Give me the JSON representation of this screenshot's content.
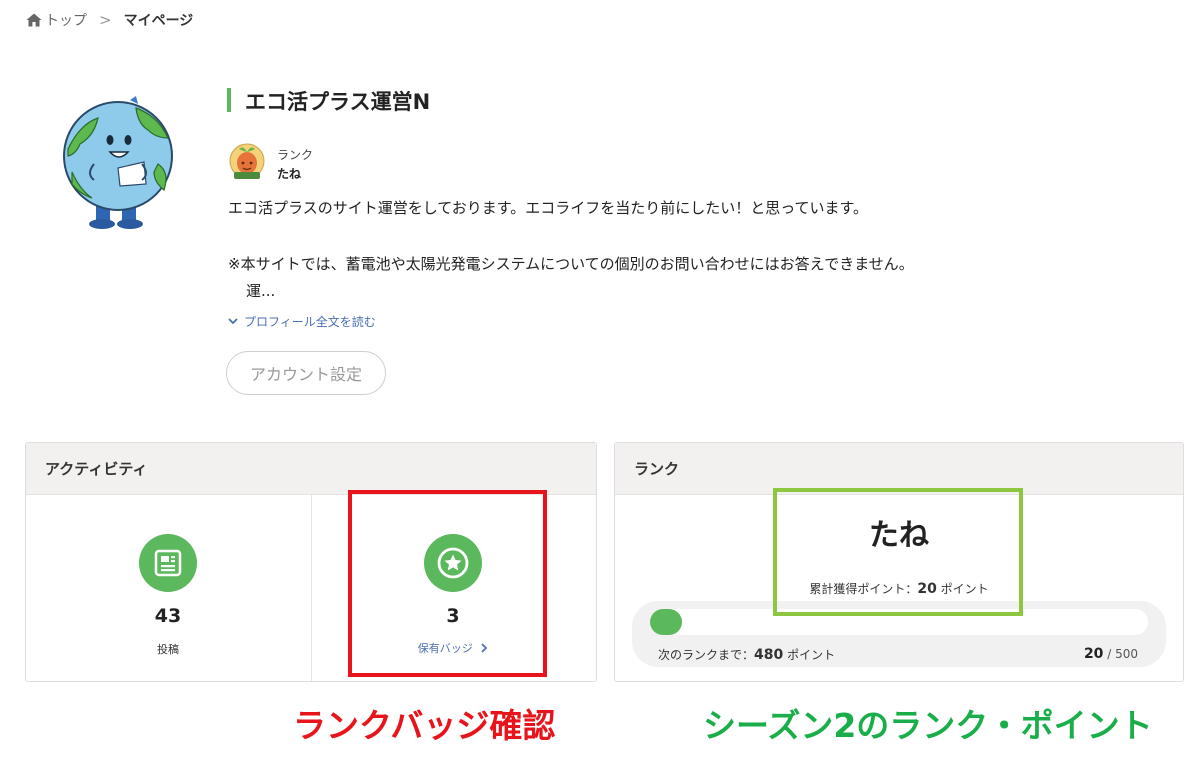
{
  "breadcrumb": {
    "home": "トップ",
    "separator": ">",
    "current": "マイページ"
  },
  "profile": {
    "name": "エコ活プラス運営N",
    "rank_caption": "ランク",
    "rank_name": "たね",
    "bio_line1": "エコ活プラスのサイト運営をしております。エコライフを当たり前にしたい！と思っています。",
    "bio_line2": "※本サイトでは、蓄電池や太陽光発電システムについての個別のお問い合わせにはお答えできません。",
    "bio_line3": "運...",
    "read_more": "プロフィール全文を読む",
    "account_button": "アカウント設定"
  },
  "activity": {
    "title": "アクティビティ",
    "posts_count": "43",
    "posts_label": "投稿",
    "badges_count": "3",
    "badges_label": "保有バッジ"
  },
  "rank": {
    "title": "ランク",
    "name": "たね",
    "total_label": "累計獲得ポイント：",
    "total_value": "20",
    "points_unit": "ポイント",
    "next_label": "次のランクまで：",
    "next_value": "480",
    "progress_current": "20",
    "progress_total": "500",
    "progress_fraction": 0.04
  },
  "annotations": {
    "red_label": "ランクバッジ確認",
    "green_label": "シーズン2のランク・ポイント",
    "red_color": "#e8141b",
    "green_box_color": "#8dc63f",
    "green_text_color": "#1aae4a"
  },
  "colors": {
    "accent": "#5cb85c",
    "link": "#4a6fb5"
  },
  "icons": [
    "home-icon",
    "chevron-down-icon",
    "article-icon",
    "star-badge-icon",
    "chevron-right-icon"
  ]
}
